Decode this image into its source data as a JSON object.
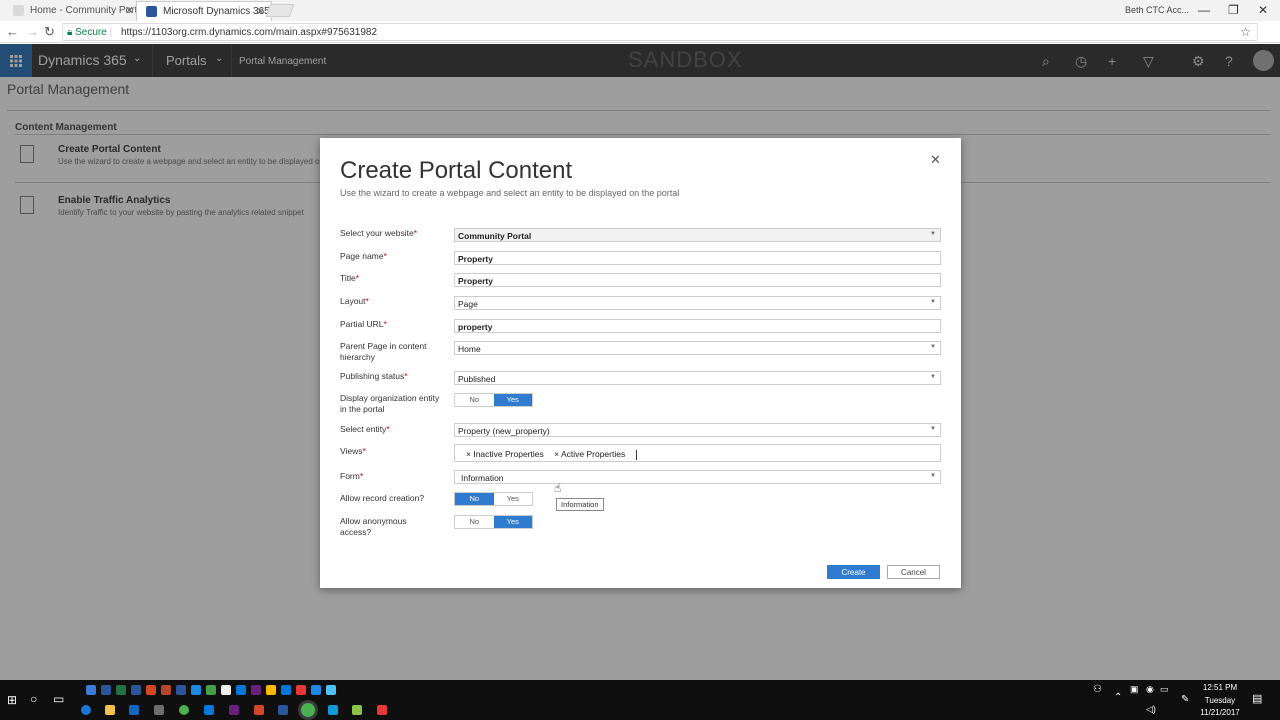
{
  "browser": {
    "tabs": [
      {
        "label": "Home - Community Porta",
        "active": false
      },
      {
        "label": "Microsoft Dynamics 365",
        "active": true
      }
    ],
    "user_label": "Beth CTC Acc...",
    "secure_label": "Secure",
    "url": "https://1103org.crm.dynamics.com/main.aspx#975631982"
  },
  "topbar": {
    "app_name": "Dynamics 365",
    "area": "Portals",
    "breadcrumb": "Portal Management",
    "environment_label": "SANDBOX"
  },
  "page": {
    "title": "Portal Management",
    "section_title": "Content Management",
    "items": [
      {
        "title": "Create Portal Content",
        "desc": "Use the wizard to create a webpage and select an entity to be displayed on the po"
      },
      {
        "title": "Enable Traffic Analytics",
        "desc": "Identify Traffic to your website by pasting the analytics related snippet"
      }
    ]
  },
  "dialog": {
    "title": "Create Portal Content",
    "subtitle": "Use the wizard to create a webpage and select an entity to be displayed on the portal",
    "fields": {
      "website": {
        "label": "Select your website",
        "value": "Community Portal"
      },
      "page_name": {
        "label": "Page name",
        "value": "Property"
      },
      "title": {
        "label": "Title",
        "value": "Property"
      },
      "layout": {
        "label": "Layout",
        "value": "Page"
      },
      "partial_url": {
        "label": "Partial URL",
        "value": "property"
      },
      "parent_page": {
        "label": "Parent Page in content hierarchy",
        "value": "Home"
      },
      "publishing_status": {
        "label": "Publishing status",
        "value": "Published"
      },
      "display_org": {
        "label": "Display organization entity in the portal",
        "no": "No",
        "yes": "Yes",
        "selected": "Yes"
      },
      "entity": {
        "label": "Select entity",
        "value": "Property (new_property)"
      },
      "views": {
        "label": "Views",
        "chips": [
          "Inactive Properties",
          "Active Properties"
        ]
      },
      "form": {
        "label": "Form",
        "value": "Information"
      },
      "allow_create": {
        "label": "Allow record creation?",
        "no": "No",
        "yes": "Yes",
        "selected": "No"
      },
      "allow_anon": {
        "label": "Allow anonymous access?",
        "no": "No",
        "yes": "Yes",
        "selected": "Yes"
      }
    },
    "tooltip": "Information",
    "create_label": "Create",
    "cancel_label": "Cancel"
  },
  "taskbar": {
    "time": "12:51 PM",
    "day": "Tuesday",
    "date": "11/21/2017"
  },
  "colors": {
    "accent": "#2e7bcf",
    "topbar": "#454545",
    "waffle": "#3b7cbf",
    "required": "#cc0000"
  }
}
